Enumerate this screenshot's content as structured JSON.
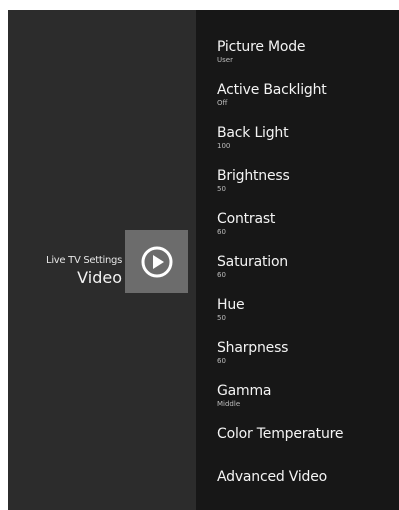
{
  "section": {
    "subtitle": "Live TV Settings",
    "title": "Video",
    "icon": "play-circle-icon"
  },
  "menu": {
    "items": [
      {
        "label": "Picture Mode",
        "value": "User"
      },
      {
        "label": "Active Backlight",
        "value": "Off"
      },
      {
        "label": "Back Light",
        "value": "100"
      },
      {
        "label": "Brightness",
        "value": "50"
      },
      {
        "label": "Contrast",
        "value": "60"
      },
      {
        "label": "Saturation",
        "value": "60"
      },
      {
        "label": "Hue",
        "value": "50"
      },
      {
        "label": "Sharpness",
        "value": "60"
      },
      {
        "label": "Gamma",
        "value": "Middle"
      },
      {
        "label": "Color Temperature",
        "value": ""
      },
      {
        "label": "Advanced Video",
        "value": ""
      }
    ]
  },
  "colors": {
    "left_panel_bg": "#2c2c2c",
    "right_panel_bg": "#171717",
    "icon_box_bg": "#6c6c6c",
    "text_primary": "#f4f4f4",
    "text_secondary": "#bdbdbd"
  }
}
